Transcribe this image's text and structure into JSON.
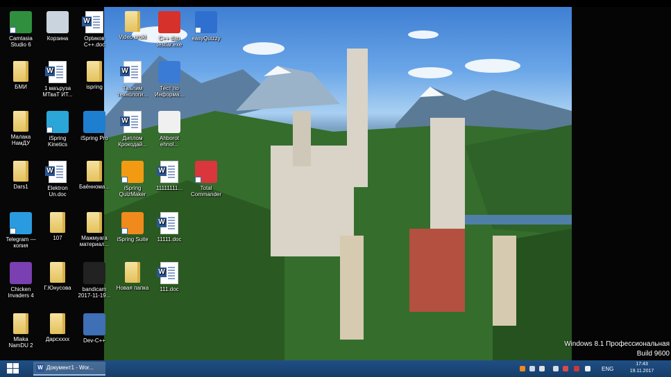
{
  "desktop_icons": [
    {
      "label": "Camtasia Studio 6",
      "kind": "generic",
      "color": "#2f8f3f",
      "shortcut": true
    },
    {
      "label": "Корзина",
      "kind": "generic",
      "color": "#c9d4de",
      "shortcut": false
    },
    {
      "label": "Optикoв C++.doc",
      "kind": "word",
      "shortcut": false
    },
    {
      "label": "Video uroki",
      "kind": "folder",
      "shortcut": false
    },
    {
      "label": "C++ dan testlar.exe",
      "kind": "generic",
      "color": "#d6312b",
      "shortcut": false
    },
    {
      "label": "easyQuizzy",
      "kind": "generic",
      "color": "#2f6fd0",
      "shortcut": true
    },
    {
      "label": "БМИ",
      "kind": "folder",
      "shortcut": false
    },
    {
      "label": "1 маъруза МТваТ ИТ...",
      "kind": "word",
      "shortcut": false
    },
    {
      "label": "ispring",
      "kind": "folder",
      "shortcut": false
    },
    {
      "label": "Таълим технологи...",
      "kind": "word",
      "shortcut": false
    },
    {
      "label": "Тест по Информа...",
      "kind": "generic",
      "color": "#3a7bd5",
      "shortcut": false
    },
    {
      "label": "Малака НамДУ",
      "kind": "folder",
      "shortcut": false
    },
    {
      "label": "iSpring Kinetics",
      "kind": "generic",
      "color": "#2aa7d8",
      "shortcut": true
    },
    {
      "label": "iSpring Pro",
      "kind": "generic",
      "color": "#1e7fd0",
      "shortcut": false
    },
    {
      "label": "Диплом Крокодай...",
      "kind": "word",
      "shortcut": false
    },
    {
      "label": "Ahborot ehnol...",
      "kind": "generic",
      "color": "#f0f0f0",
      "shortcut": false
    },
    {
      "label": "Dars1",
      "kind": "folder",
      "shortcut": false
    },
    {
      "label": "Elektron Un.doc",
      "kind": "word",
      "shortcut": false
    },
    {
      "label": "Баённома...",
      "kind": "folder",
      "shortcut": false
    },
    {
      "label": "iSpring QuizMaker",
      "kind": "generic",
      "color": "#f29b12",
      "shortcut": true
    },
    {
      "label": "11111111...",
      "kind": "word",
      "shortcut": false
    },
    {
      "label": "Total Commander",
      "kind": "generic",
      "color": "#d9363e",
      "shortcut": true
    },
    {
      "label": "Telegram — копия",
      "kind": "generic",
      "color": "#2b9be0",
      "shortcut": true
    },
    {
      "label": "107",
      "kind": "folder",
      "shortcut": false
    },
    {
      "label": "Мажмуага материал...",
      "kind": "folder",
      "shortcut": false
    },
    {
      "label": "iSpring Suite",
      "kind": "generic",
      "color": "#f08a1d",
      "shortcut": true
    },
    {
      "label": "11111.doc",
      "kind": "word",
      "shortcut": false
    },
    {
      "label": "Chicken Invaders 4",
      "kind": "generic",
      "color": "#7a3fb0",
      "shortcut": false
    },
    {
      "label": "Г.Юнусова",
      "kind": "folder",
      "shortcut": false
    },
    {
      "label": "bandicam 2017-11-19...",
      "kind": "generic",
      "color": "#222222",
      "shortcut": false
    },
    {
      "label": "Новая папка",
      "kind": "folder",
      "shortcut": false
    },
    {
      "label": "111.doc",
      "kind": "word",
      "shortcut": false
    },
    {
      "label": "Mlaka NamDU 2",
      "kind": "folder",
      "shortcut": false
    },
    {
      "label": "Дарсxxxx",
      "kind": "folder",
      "shortcut": false
    },
    {
      "label": "Dev-C++",
      "kind": "generic",
      "color": "#3f6fb5",
      "shortcut": false
    }
  ],
  "watermark": {
    "line1": "Windows 8.1 Профессиональная",
    "line2": "Build 9600"
  },
  "taskbar": {
    "active_window": "Документ1 - Wor...",
    "language": "ENG",
    "time": "17:43",
    "date": "19.11.2017"
  },
  "colors": {
    "taskbar": "#1a4576",
    "accent": "#2b5797"
  }
}
